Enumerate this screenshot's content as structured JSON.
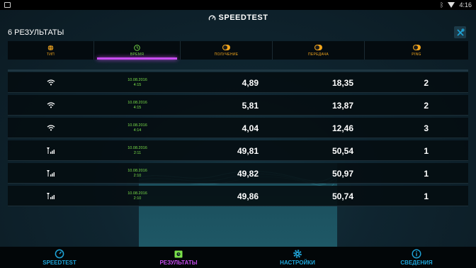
{
  "status": {
    "time": "4:16"
  },
  "app": {
    "title": "SPEEDTEST"
  },
  "results": {
    "title": "6 РЕЗУЛЬТАТЫ"
  },
  "columns": [
    {
      "key": "type",
      "label": "ТИП",
      "icon": "globe-icon",
      "active": false
    },
    {
      "key": "time",
      "label": "ВРЕМЯ",
      "icon": "clock-icon",
      "active": true
    },
    {
      "key": "download",
      "label": "ПОЛУЧЕНИЕ",
      "icon": "download-icon",
      "unit": "Mbps",
      "active": false
    },
    {
      "key": "upload",
      "label": "ПЕРЕДАЧА",
      "icon": "upload-icon",
      "unit": "Mbps",
      "active": false
    },
    {
      "key": "ping",
      "label": "PING",
      "icon": "ping-icon",
      "unit": "ms",
      "active": false
    }
  ],
  "rows": [
    {
      "conn": "wifi-icon",
      "date": "10.08.2016",
      "time": "4:15",
      "download": "4,89",
      "upload": "18,35",
      "ping": "2"
    },
    {
      "conn": "wifi-icon",
      "date": "10.08.2016",
      "time": "4:15",
      "download": "5,81",
      "upload": "13,87",
      "ping": "2"
    },
    {
      "conn": "wifi-icon",
      "date": "10.08.2016",
      "time": "4:14",
      "download": "4,04",
      "upload": "12,46",
      "ping": "3"
    },
    {
      "conn": "cellular-icon",
      "date": "10.08.2016",
      "time": "2:11",
      "download": "49,81",
      "upload": "50,54",
      "ping": "1"
    },
    {
      "conn": "cellular-icon",
      "date": "10.08.2016",
      "time": "2:10",
      "download": "49,82",
      "upload": "50,97",
      "ping": "1"
    },
    {
      "conn": "cellular-icon",
      "date": "10.08.2016",
      "time": "2:10",
      "download": "49,86",
      "upload": "50,74",
      "ping": "1"
    }
  ],
  "nav": [
    {
      "label": "SPEEDTEST",
      "icon": "speedometer-icon",
      "active": false
    },
    {
      "label": "РЕЗУЛЬТАТЫ",
      "icon": "results-icon",
      "active": true
    },
    {
      "label": "НАСТРОЙКИ",
      "icon": "gear-icon",
      "active": false
    },
    {
      "label": "СВЕДЕНИЯ",
      "icon": "info-icon",
      "active": false
    }
  ],
  "colors": {
    "accent_orange": "#f2a51c",
    "accent_green": "#7be04a",
    "accent_purple": "#c84cf0",
    "accent_blue": "#1fa4d8"
  }
}
